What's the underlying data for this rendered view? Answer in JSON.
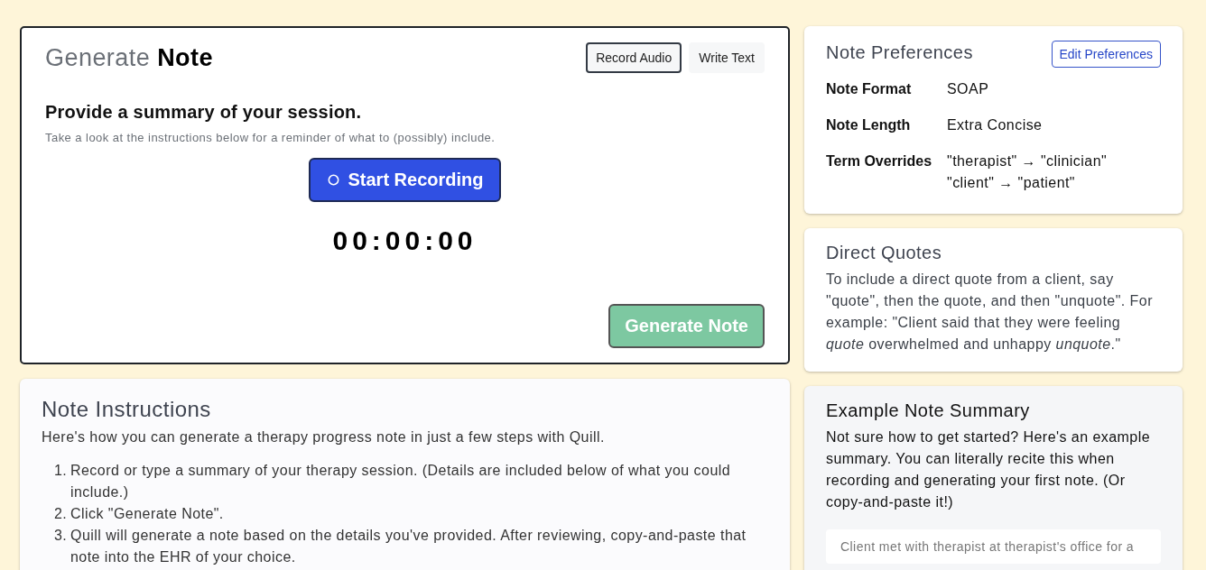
{
  "generate_note": {
    "title_light": "Generate",
    "title_bold": "Note",
    "modes": [
      {
        "label": "Record Audio",
        "selected": true
      },
      {
        "label": "Write Text",
        "selected": false
      }
    ],
    "heading": "Provide a summary of your session.",
    "hint": "Take a look at the instructions below for a reminder of what to (possibly) include.",
    "record_button": "Start Recording",
    "timer": "00:00:00",
    "generate_button": {
      "label": "Generate Note",
      "disabled": true
    }
  },
  "note_instructions": {
    "title": "Note Instructions",
    "intro": "Here's how you can generate a therapy progress note in just a few steps with Quill.",
    "steps": [
      {
        "number": "1.",
        "text": "Record or type a summary of your therapy session. (Details are included below of what you could include.)"
      },
      {
        "number": "2.",
        "text": "Click \"Generate Note\"."
      },
      {
        "number": "3.",
        "text": "Quill will generate a note based on the details you've provided. After reviewing, copy-and-paste that note into the EHR of your choice."
      }
    ]
  },
  "note_preferences": {
    "title": "Note Preferences",
    "edit_button": "Edit Preferences",
    "rows": [
      {
        "label": "Note Format",
        "values": [
          "SOAP"
        ]
      },
      {
        "label": "Note Length",
        "values": [
          "Extra Concise"
        ]
      },
      {
        "label": "Term Overrides",
        "values": [
          "\"therapist\" → \"clinician\"",
          "\"client\" → \"patient\""
        ]
      }
    ]
  },
  "direct_quotes": {
    "title": "Direct Quotes",
    "text": "To include a direct quote from a client, say \"quote\", then the quote, and then \"unquote\". For example: \"Client said that they were feeling *quote* overwhelmed and unhappy *unquote*.\""
  },
  "example_note_summary": {
    "title": "Example Note Summary",
    "text": "Not sure how to get started? Here's an example summary. You can literally recite this when recording and generating your first note. (Or copy-and-paste it!)",
    "example": "Client met with therapist at therapist's office for a"
  }
}
